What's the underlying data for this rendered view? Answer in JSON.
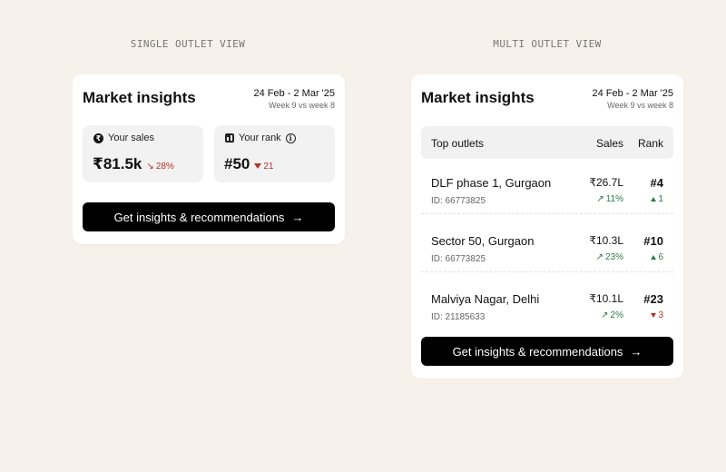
{
  "labels": {
    "single_view": "SINGLE OUTLET VIEW",
    "multi_view": "MULTI OUTLET VIEW"
  },
  "single": {
    "title": "Market insights",
    "date_range": "24 Feb - 2 Mar '25",
    "week_compare": "Week 9 vs week 8",
    "sales": {
      "label": "Your sales",
      "icon": "rupee-icon",
      "value": "₹81.5k",
      "delta": "28%",
      "trend": "down"
    },
    "rank": {
      "label": "Your rank",
      "icon": "bar-chart-icon",
      "value": "#50",
      "delta": "21",
      "trend": "down"
    },
    "cta": {
      "label": "Get insights & recommendations",
      "icon": "arrow-right-icon"
    }
  },
  "multi": {
    "title": "Market insights",
    "date_range": "24 Feb - 2 Mar '25",
    "week_compare": "Week 9 vs week 8",
    "table": {
      "col_outlet": "Top outlets",
      "col_sales": "Sales",
      "col_rank": "Rank"
    },
    "outlets": [
      {
        "name": "DLF phase 1, Gurgaon",
        "id": "ID: 66773825",
        "sales": "₹26.7L",
        "sales_delta": "11%",
        "sales_trend": "up",
        "rank": "#4",
        "rank_delta": "1",
        "rank_trend": "up"
      },
      {
        "name": "Sector 50, Gurgaon",
        "id": "ID: 66773825",
        "sales": "₹10.3L",
        "sales_delta": "23%",
        "sales_trend": "up",
        "rank": "#10",
        "rank_delta": "6",
        "rank_trend": "up"
      },
      {
        "name": "Malviya Nagar, Delhi",
        "id": "ID: 21185633",
        "sales": "₹10.1L",
        "sales_delta": "2%",
        "sales_trend": "up",
        "rank": "#23",
        "rank_delta": "3",
        "rank_trend": "down"
      }
    ],
    "cta": {
      "label": "Get insights & recommendations",
      "icon": "arrow-right-icon"
    }
  },
  "colors": {
    "background": "#f6f1ea",
    "positive": "#2d7a4a",
    "negative": "#b5312b",
    "button": "#000000"
  }
}
